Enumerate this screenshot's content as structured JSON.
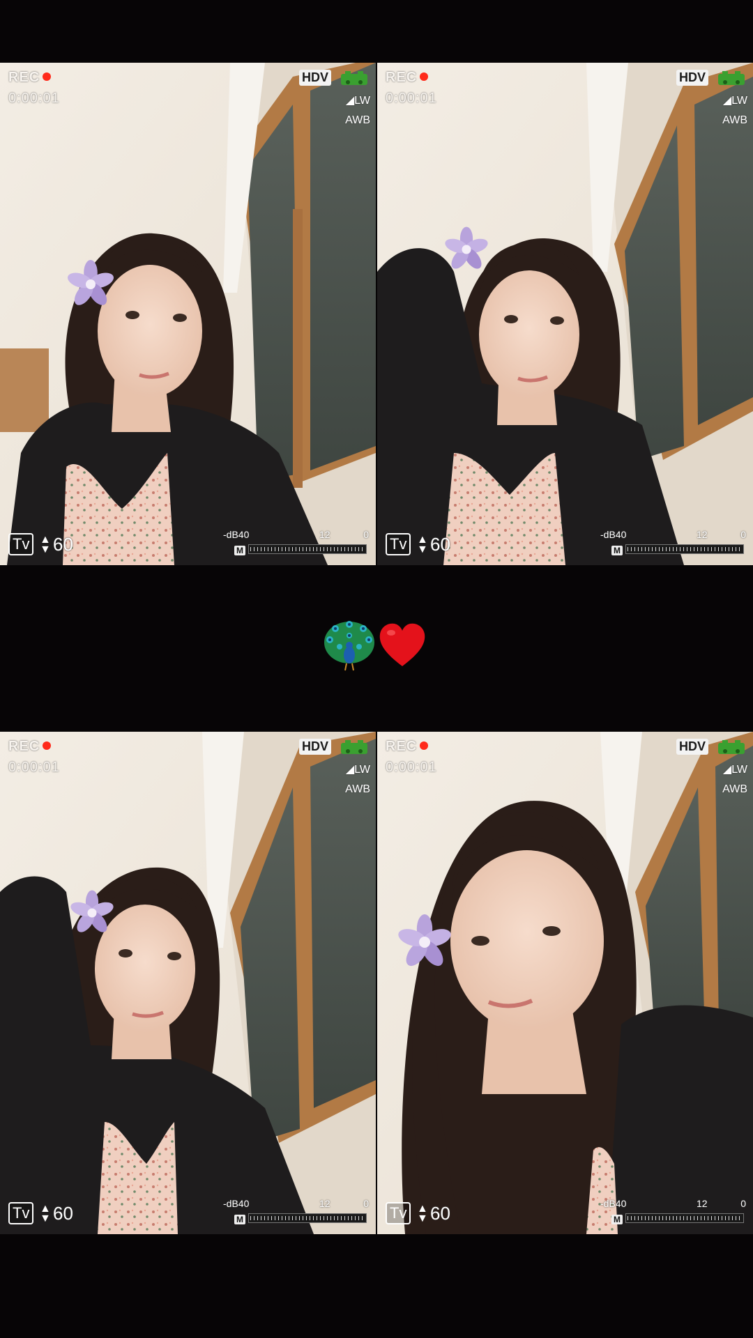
{
  "frames": [
    {
      "rec": "REC",
      "timecode": "0:00:01",
      "hdv": "HDV",
      "lw": "LW",
      "awb": "AWB",
      "tv": "Tv",
      "tv_value": "60",
      "db": "-dB40",
      "scale_mid": "12",
      "scale_end": "0",
      "meter_mode": "M"
    },
    {
      "rec": "REC",
      "timecode": "0:00:01",
      "hdv": "HDV",
      "lw": "LW",
      "awb": "AWB",
      "tv": "Tv",
      "tv_value": "60",
      "db": "-dB40",
      "scale_mid": "12",
      "scale_end": "0",
      "meter_mode": "M"
    },
    {
      "rec": "REC",
      "timecode": "0:00:01",
      "hdv": "HDV",
      "lw": "LW",
      "awb": "AWB",
      "tv": "Tv",
      "tv_value": "60",
      "db": "-dB40",
      "scale_mid": "12",
      "scale_end": "0",
      "meter_mode": "M"
    },
    {
      "rec": "REC",
      "timecode": "0:00:01",
      "hdv": "HDV",
      "lw": "LW",
      "awb": "AWB",
      "tv": "Tv",
      "tv_value": "60",
      "db": "-dB40",
      "scale_mid": "12",
      "scale_end": "0",
      "meter_mode": "M"
    }
  ],
  "center": {
    "emojis": [
      "peacock-icon",
      "heart-icon"
    ]
  },
  "colors": {
    "background": "#070506",
    "rec_dot": "#ff2a1a",
    "heart": "#e4121b",
    "battery": "#3aa030"
  }
}
